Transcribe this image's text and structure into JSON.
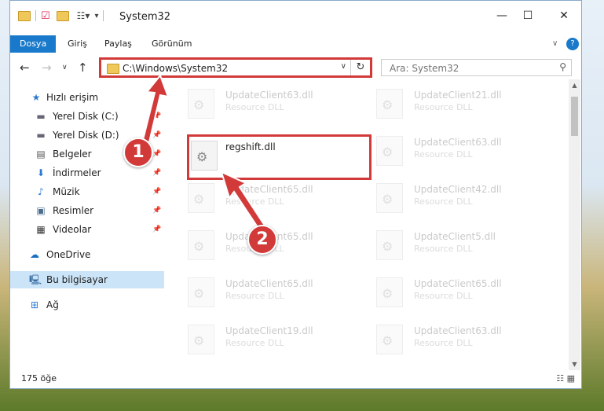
{
  "window": {
    "title": "System32",
    "controls": {
      "minimize": "—",
      "maximize": "☐",
      "close": "✕"
    }
  },
  "ribbon": {
    "tabs": [
      "Dosya",
      "Giriş",
      "Paylaş",
      "Görünüm"
    ],
    "help": "?"
  },
  "address": {
    "path": "C:\\Windows\\System32",
    "refresh": "↻",
    "dropdown": "∨"
  },
  "search": {
    "placeholder": "Ara: System32"
  },
  "sidebar": {
    "items": [
      {
        "label": "Hızlı erişim",
        "icon": "star-icon",
        "glyph": "★"
      },
      {
        "label": "Yerel Disk (C:)",
        "icon": "drive-icon",
        "glyph": "▬"
      },
      {
        "label": "Yerel Disk (D:)",
        "icon": "drive-icon",
        "glyph": "▬"
      },
      {
        "label": "Belgeler",
        "icon": "documents-icon",
        "glyph": "▤"
      },
      {
        "label": "İndirmeler",
        "icon": "download-icon",
        "glyph": "⬇"
      },
      {
        "label": "Müzik",
        "icon": "music-icon",
        "glyph": "♪"
      },
      {
        "label": "Resimler",
        "icon": "pictures-icon",
        "glyph": "▣"
      },
      {
        "label": "Videolar",
        "icon": "videos-icon",
        "glyph": "▦"
      },
      {
        "label": "OneDrive",
        "icon": "cloud-icon",
        "glyph": "☁"
      },
      {
        "label": "Bu bilgisayar",
        "icon": "computer-icon",
        "glyph": "🖳"
      },
      {
        "label": "Ağ",
        "icon": "network-icon",
        "glyph": "⊞"
      }
    ]
  },
  "files": {
    "highlighted": {
      "name": "regshift.dll"
    },
    "items": [
      {
        "name": "UpdateClient63.dll",
        "type": "Resource DLL"
      },
      {
        "name": "UpdateClient21.dll",
        "type": "Resource DLL"
      },
      {
        "name": "UpdateClient63.dll",
        "type": "Resource DLL"
      },
      {
        "name": "UpdateClient65.dll",
        "type": "Resource DLL"
      },
      {
        "name": "UpdateClient42.dll",
        "type": "Resource DLL"
      },
      {
        "name": "UpdateClient65.dll",
        "type": "Resource DLL"
      },
      {
        "name": "UpdateClient5.dll",
        "type": "Resource DLL"
      },
      {
        "name": "UpdateClient65.dll",
        "type": "Resource DLL"
      },
      {
        "name": "UpdateClient65.dll",
        "type": "Resource DLL"
      },
      {
        "name": "UpdateClient19.dll",
        "type": "Resource DLL"
      },
      {
        "name": "UpdateClient63.dll",
        "type": "Resource DLL"
      }
    ]
  },
  "status": {
    "count": "175 öğe"
  },
  "annotations": {
    "step1": "1",
    "step2": "2"
  }
}
